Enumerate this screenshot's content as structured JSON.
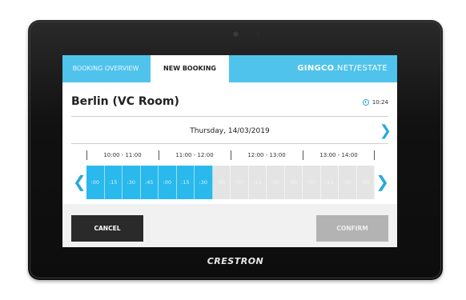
{
  "device": {
    "brand": "CRESTRON"
  },
  "header": {
    "tabs": [
      {
        "label": "BOOKING OVERVIEW",
        "active": false
      },
      {
        "label": "NEW BOOKING",
        "active": true
      }
    ],
    "logo": {
      "bold": "GINGCO",
      "rest": ".NET",
      "slash": "/",
      "tail": "ESTATE"
    },
    "accent_color": "#4fc3ec"
  },
  "room": {
    "name": "Berlin (VC Room)",
    "time": "10:24"
  },
  "date": {
    "label": "Thursday, 14/03/2019"
  },
  "hours": [
    "10:00 - 11:00",
    "11:00 - 12:00",
    "12:00 - 13:00",
    "13:00 - 14:00"
  ],
  "slots": [
    {
      "label": ":00",
      "selected": true
    },
    {
      "label": ":15",
      "selected": true
    },
    {
      "label": ":30",
      "selected": true
    },
    {
      "label": ":45",
      "selected": true
    },
    {
      "label": ":00",
      "selected": true
    },
    {
      "label": ":15",
      "selected": true
    },
    {
      "label": ":30",
      "selected": true
    },
    {
      "label": ":45",
      "selected": false
    },
    {
      "label": ":00",
      "selected": false
    },
    {
      "label": ":15",
      "selected": false
    },
    {
      "label": ":30",
      "selected": false
    },
    {
      "label": ":45",
      "selected": false
    },
    {
      "label": ":00",
      "selected": false
    },
    {
      "label": ":15",
      "selected": false
    },
    {
      "label": ":30",
      "selected": false
    },
    {
      "label": ":45",
      "selected": false
    }
  ],
  "buttons": {
    "cancel": "CANCEL",
    "confirm": "CONFIRM"
  },
  "icons": {
    "clock": "clock-icon",
    "prev": "chevron-left-icon",
    "next": "chevron-right-icon"
  }
}
